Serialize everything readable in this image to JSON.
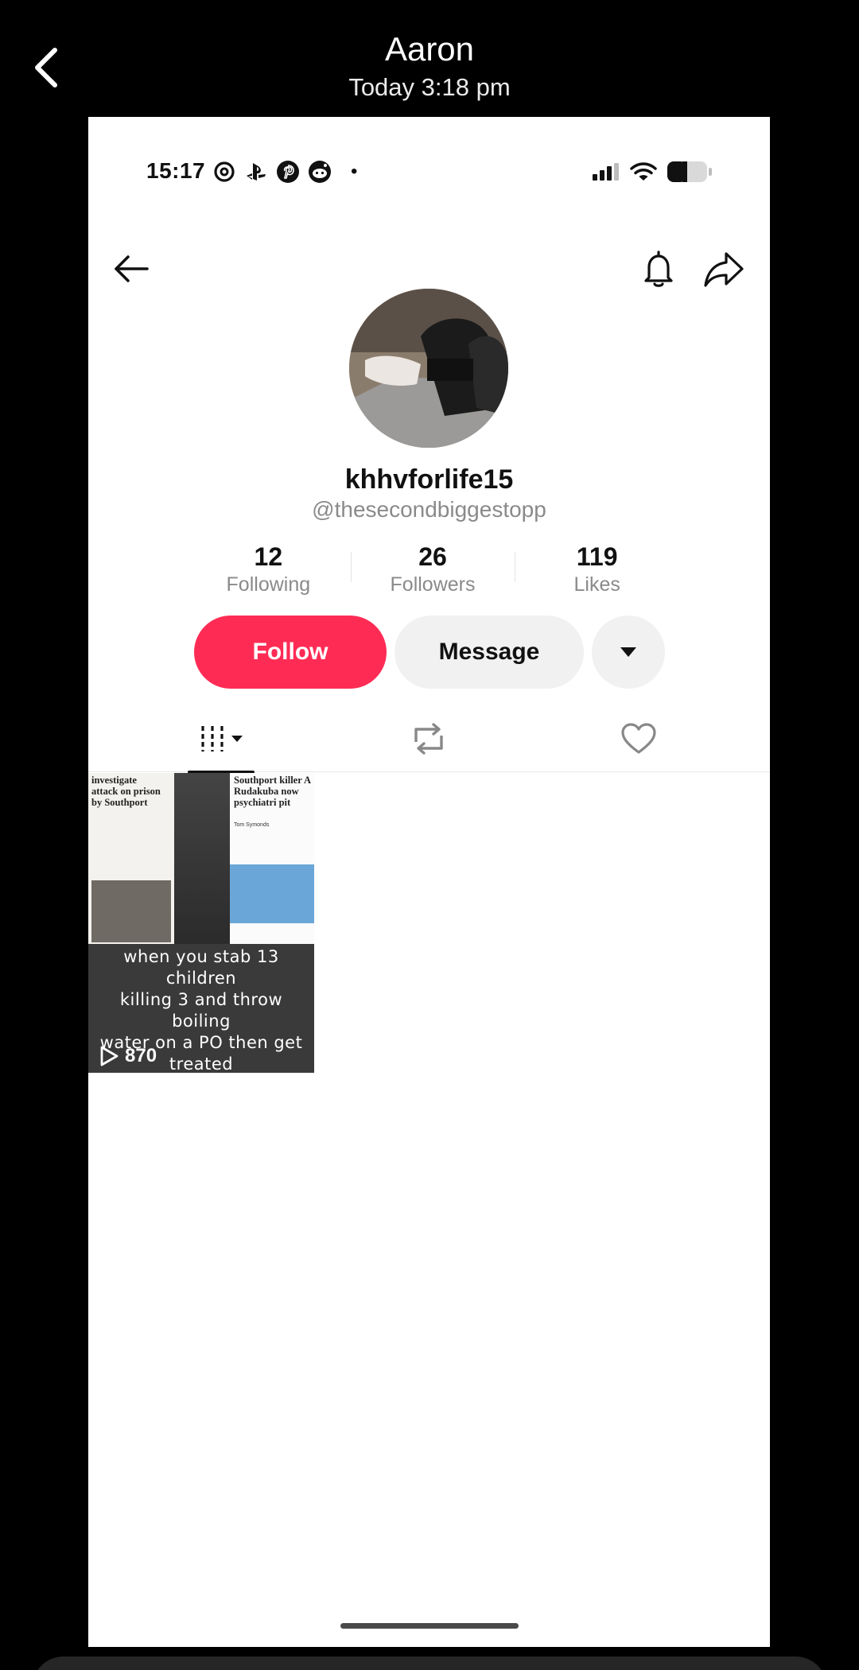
{
  "viewer": {
    "title": "Aaron",
    "subtitle": "Today 3:18 pm"
  },
  "status_bar": {
    "time": "15:17",
    "app_icons": [
      "threads-icon",
      "playstation-icon",
      "pinterest-icon",
      "reddit-icon"
    ],
    "dot": "•"
  },
  "profile": {
    "display_name": "khhvforlife15",
    "handle": "@thesecondbiggestopp",
    "stats": [
      {
        "value": "12",
        "label": "Following"
      },
      {
        "value": "26",
        "label": "Followers"
      },
      {
        "value": "119",
        "label": "Likes"
      }
    ]
  },
  "actions": {
    "follow_label": "Follow",
    "message_label": "Message"
  },
  "colors": {
    "follow": "#fe2c55",
    "secondary_button": "#f1f1f2"
  },
  "videos": [
    {
      "left_headline": "investigate\nattack on prison\nby Southport",
      "right_headline": "Southport killer A\nRudakuba     now\npsychiatri       pit",
      "right_author": "Tom Symonds",
      "caption": "when you stab 13 children\nkilling 3 and throw boiling\nwater on a PO then get treated\nlike a king in hospital:",
      "views": "870"
    }
  ]
}
